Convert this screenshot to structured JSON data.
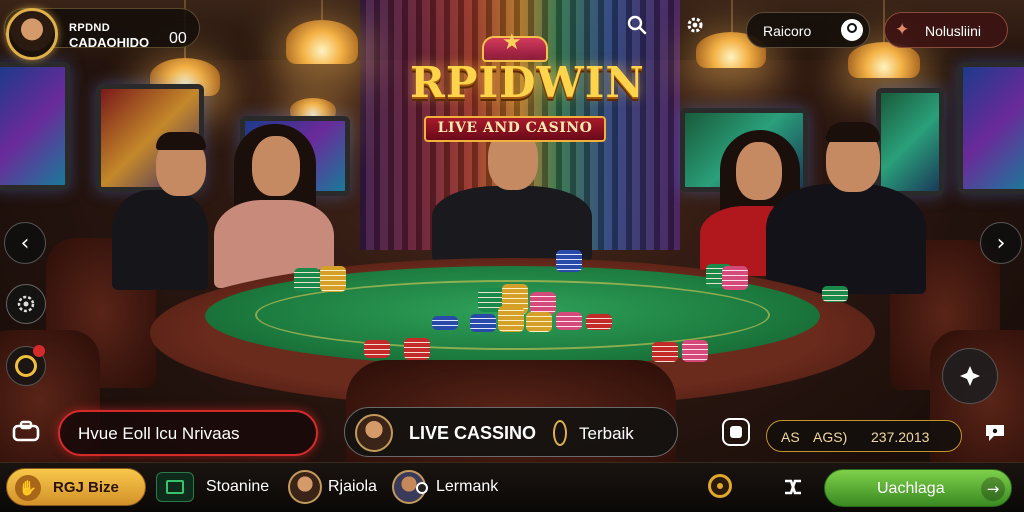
{
  "header": {
    "brand_line1": "RPDND",
    "brand_line2": "CADAOHIDO",
    "brand_count": "00",
    "search_icon": "search-icon",
    "settings_icon": "gear-icon",
    "user_pill_label": "Raicoro",
    "user_pill_icon": "user-icon",
    "action_pill_label": "Nolusliini",
    "action_pill_icon": "star-icon"
  },
  "logo": {
    "title": "RPIDWIN",
    "subtitle": "LIVE AND CASINO"
  },
  "side_left": {
    "prev_icon": "chevron-left-icon",
    "settings_icon": "gear-icon",
    "badge_icon": "coin-icon"
  },
  "side_right": {
    "next_icon": "chevron-right-icon",
    "fullscreen_icon": "expand-icon"
  },
  "mid_row": {
    "promo_label": "Hvue Eoll lcu Nrivaas",
    "live_title": "LIVE CASSINO",
    "live_suffix": "Terbaik",
    "balance_prefix": "AS",
    "balance_code": "AGS)",
    "balance_value": "237.2013"
  },
  "bottom": {
    "bonus_label": "RGJ Bize",
    "item1_label": "Stoanine",
    "item2_label": "Rjaiola",
    "item3_label": "Lermank",
    "cta_label": "Uachlaga"
  },
  "colors": {
    "felt": "#1c7a3e",
    "gold": "#ffd34a",
    "cta_green": "#5aa83a",
    "promo_red": "#d42a2a"
  }
}
